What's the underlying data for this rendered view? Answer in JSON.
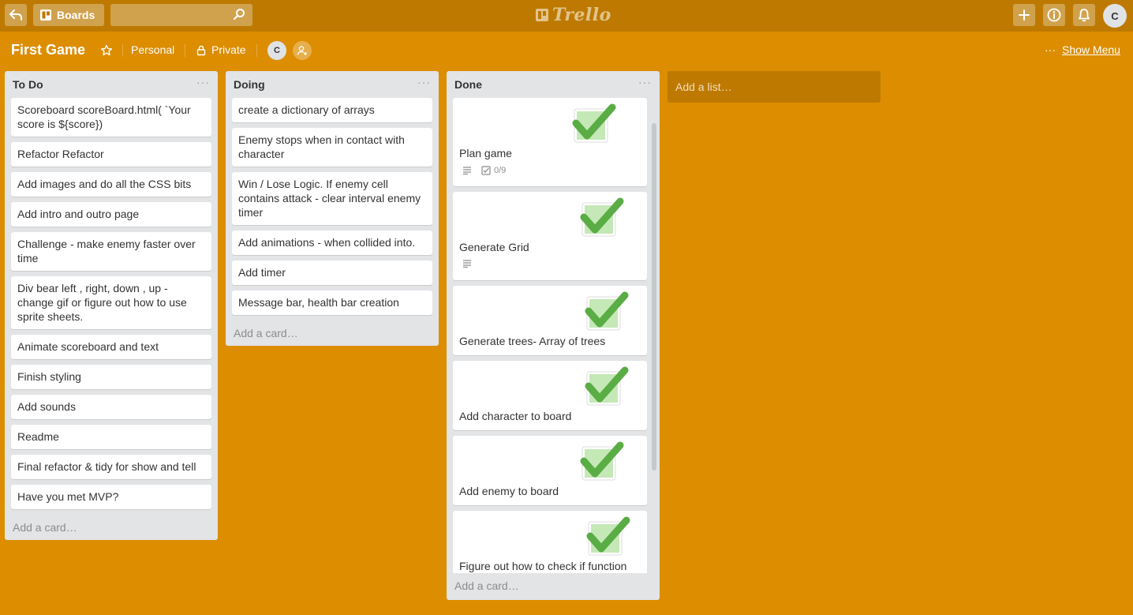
{
  "header": {
    "boards_label": "Boards",
    "search_placeholder": "",
    "logo_text": "Trello",
    "user_initial": "C"
  },
  "board": {
    "title": "First Game",
    "team": "Personal",
    "visibility": "Private",
    "member_initial": "C",
    "show_menu": "Show Menu",
    "menu_dots": "···"
  },
  "lists": [
    {
      "title": "To Do",
      "menu": "···",
      "cards": [
        "Scoreboard scoreBoard.html( `Your score is ${score})",
        "Refactor Refactor",
        "Add images and do all the CSS bits",
        "Add intro and outro page",
        "Challenge - make enemy faster over time",
        "Div bear left , right, down , up - change gif or figure out how to use sprite sheets.",
        "Animate scoreboard and text",
        "Finish styling",
        "Add sounds",
        "Readme",
        "Final refactor & tidy for show and tell",
        "Have you met MVP?"
      ],
      "add_card": "Add a card…"
    },
    {
      "title": "Doing",
      "menu": "···",
      "cards": [
        "create a dictionary of arrays",
        "Enemy stops when in contact with character",
        "Win / Lose Logic. If enemy cell contains attack - clear interval enemy timer",
        "Add animations - when collided into.",
        "Add timer",
        "Message bar, health bar creation"
      ],
      "add_card": "Add a card…"
    },
    {
      "title": "Done",
      "menu": "···",
      "cards": [
        "Plan game",
        "Generate Grid",
        "Generate trees- Array of trees",
        "Add character to board",
        "Add enemy to board",
        "Figure out how to check if function"
      ],
      "checklist": "0/9",
      "add_card": "Add a card…"
    }
  ],
  "add_list": "Add a list…",
  "colors": {
    "board_bg": "#DC8D00",
    "header_bg": "#BE7A00",
    "check_green": "#61BD4F"
  }
}
